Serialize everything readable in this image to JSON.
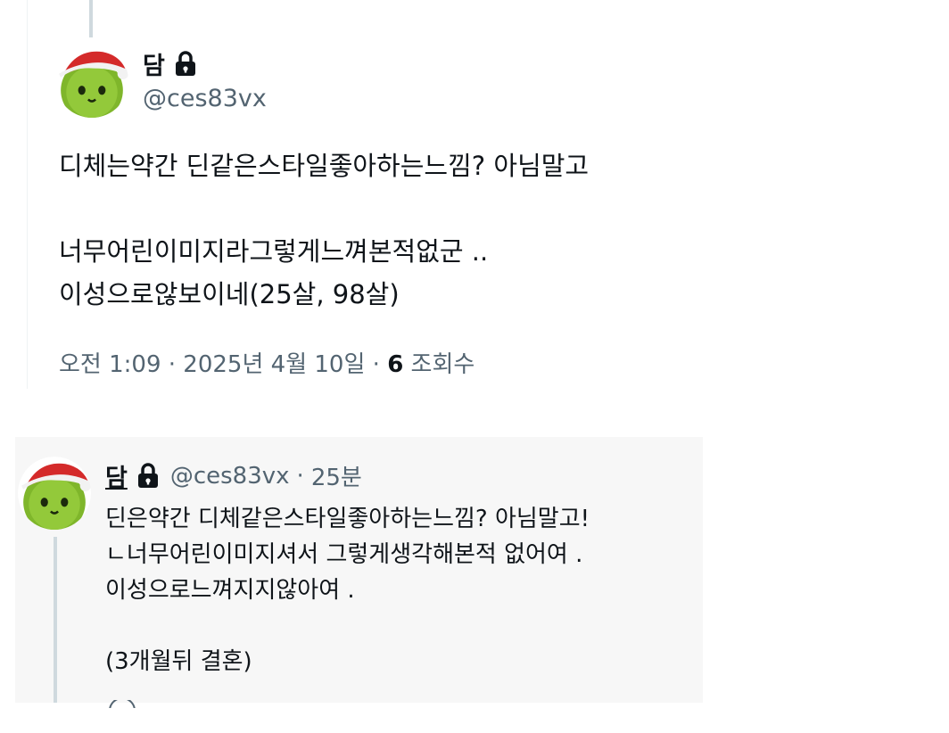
{
  "colors": {
    "text_primary": "#0f1419",
    "text_secondary": "#536471",
    "thread_line": "#cfd9de",
    "reply_bg": "#f7f7f7"
  },
  "main_tweet": {
    "avatar_icon": "santa-hat-green-creature-avatar",
    "display_name": "담",
    "protected_icon": "lock-icon",
    "handle": "@ces83vx",
    "text_lines": [
      "디체는약간 딘같은스타일좋아하는느낌? 아님말고",
      "",
      "너무어린이미지라그렇게느껴본적없군 ..",
      "이성으로않보이네(25살, 98살)"
    ],
    "meta": {
      "time": "오전 1:09",
      "separator": "·",
      "date": "2025년 4월 10일",
      "views_count": "6",
      "views_label": "조회수"
    }
  },
  "reply_tweet": {
    "avatar_icon": "santa-hat-green-creature-avatar",
    "display_name": "담",
    "protected_icon": "lock-icon",
    "handle": "@ces83vx",
    "separator": "·",
    "time_ago": "25분",
    "text_lines": [
      "딘은약간 디체같은스타일좋아하는느낌? 아님말고!",
      "ㄴ너무어린이미지셔서 그렇게생각해본적 없어여 .",
      "이성으로느껴지지않아여 .",
      "",
      "(3개월뒤 결혼)"
    ]
  }
}
